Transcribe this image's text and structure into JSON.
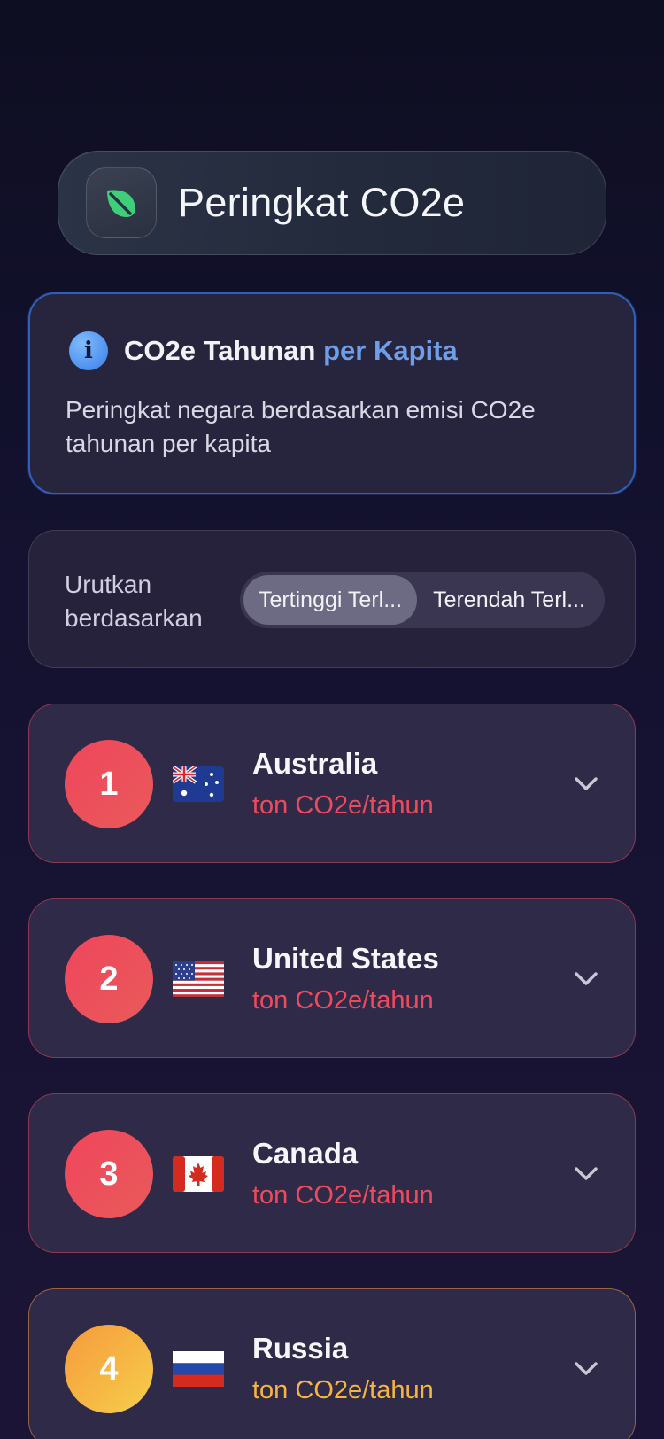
{
  "header": {
    "title": "Peringkat CO2e",
    "logo_icon": "leaf-icon",
    "logo_color": "#3fcf7a"
  },
  "info": {
    "icon": "info-icon",
    "heading_main": "CO2e Tahunan",
    "heading_accent": "per Kapita",
    "description": "Peringkat negara berdasarkan emisi CO2e tahunan per kapita"
  },
  "sort": {
    "label": "Urutkan berdasarkan",
    "options": [
      "Tertinggi Terl...",
      "Terendah Terl..."
    ],
    "selected": "Tertinggi Terl..."
  },
  "rankings": [
    {
      "rank": "1",
      "country": "Australia",
      "unit": "ton CO2e/tahun",
      "flag": "australia-flag-icon",
      "tone": "#ee4a5e"
    },
    {
      "rank": "2",
      "country": "United States",
      "unit": "ton CO2e/tahun",
      "flag": "usa-flag-icon",
      "tone": "#ee4a5e"
    },
    {
      "rank": "3",
      "country": "Canada",
      "unit": "ton CO2e/tahun",
      "flag": "canada-flag-icon",
      "tone": "#ee4a5e"
    },
    {
      "rank": "4",
      "country": "Russia",
      "unit": "ton CO2e/tahun",
      "flag": "russia-flag-icon",
      "tone": "#f5b540"
    }
  ]
}
